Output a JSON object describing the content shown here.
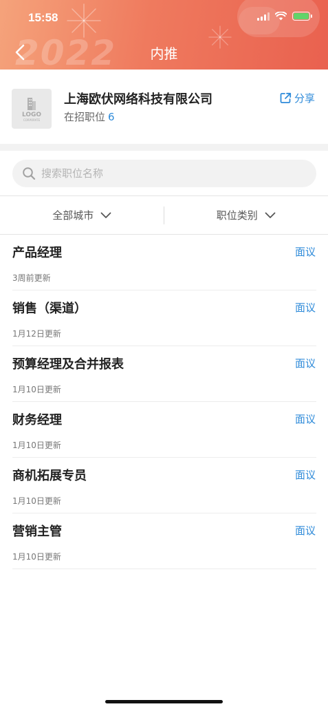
{
  "status_bar": {
    "time": "15:58"
  },
  "header": {
    "title": "内推",
    "decor_text": "2022"
  },
  "company": {
    "logo": {
      "word": "LOGO",
      "sub": "CORPORATE"
    },
    "name": "上海欧伏网络科技有限公司",
    "openings_label": "在招职位",
    "openings_count": "6",
    "share_label": "分享"
  },
  "search": {
    "placeholder": "搜索职位名称"
  },
  "filters": {
    "city": "全部城市",
    "category": "职位类别"
  },
  "jobs": [
    {
      "title": "产品经理",
      "salary": "面议",
      "updated": "3周前更新"
    },
    {
      "title": "销售（渠道）",
      "salary": "面议",
      "updated": "1月12日更新"
    },
    {
      "title": "预算经理及合并报表",
      "salary": "面议",
      "updated": "1月10日更新"
    },
    {
      "title": "财务经理",
      "salary": "面议",
      "updated": "1月10日更新"
    },
    {
      "title": "商机拓展专员",
      "salary": "面议",
      "updated": "1月10日更新"
    },
    {
      "title": "营销主管",
      "salary": "面议",
      "updated": "1月10日更新"
    }
  ],
  "colors": {
    "accent": "#2d8ad9",
    "header_start": "#f5a37b",
    "header_end": "#e9614f"
  }
}
